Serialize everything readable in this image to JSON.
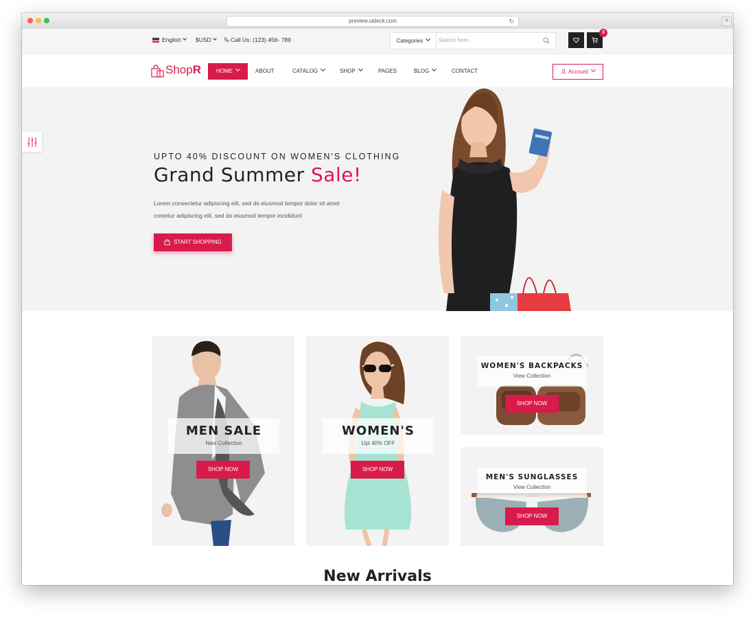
{
  "browser": {
    "url": "preview.uideck.com"
  },
  "topbar": {
    "language": "English",
    "currency": "$USD",
    "phone": "Call Us: (123) 456- 789",
    "categories_label": "Categories",
    "search_placeholder": "Search here...",
    "cart_count": "3"
  },
  "nav": {
    "logo_main": "Shop",
    "logo_accent": "R",
    "items": [
      {
        "label": "HOME",
        "has_chevron": true,
        "active": true
      },
      {
        "label": "ABOUT"
      },
      {
        "label": "CATALOG",
        "has_chevron": true
      },
      {
        "label": "SHOP",
        "has_chevron": true
      },
      {
        "label": "PAGES"
      },
      {
        "label": "BLOG",
        "has_chevron": true
      },
      {
        "label": "CONTACT"
      }
    ],
    "account_label": "Account"
  },
  "hero": {
    "subtitle": "UPTO 40% DISCOUNT ON WOMEN'S CLOTHING",
    "title_main": "Grand Summer",
    "title_accent": "Sale!",
    "text_line1": "Lorem consectetur adipiscing elit, sed do eiusmod tempor dolor sit amet",
    "text_line2": "contetur adipiscing elit, sed do eiusmod tempor incididunt",
    "button_label": "START SHOPPING"
  },
  "collections": [
    {
      "title": "MEN SALE",
      "subtitle": "New Collection",
      "button": "SHOP NOW"
    },
    {
      "title": "WOMEN'S",
      "subtitle": "Upt 40% OFF",
      "button": "SHOP NOW"
    },
    {
      "title": "WOMEN'S BACKPACKS",
      "subtitle": "View Collection",
      "button": "SHOP NOW"
    },
    {
      "title": "MEN'S SUNGLASSES",
      "subtitle": "View Collection",
      "button": "SHOP NOW"
    }
  ],
  "section": {
    "new_arrivals": "New Arrivals"
  },
  "colors": {
    "accent": "#d81b4a",
    "dark": "#222222",
    "hero_bg": "#f3f3f4"
  },
  "icons": [
    "flag-us-icon",
    "phone-icon",
    "search-icon",
    "heart-icon",
    "cart-icon",
    "user-icon",
    "bag-icon",
    "settings-sliders-icon"
  ]
}
